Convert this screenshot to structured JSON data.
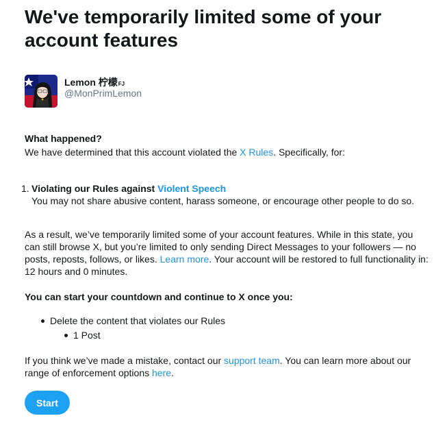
{
  "page": {
    "title_line1": "We've temporarily limited some of your",
    "title_line2": "account features"
  },
  "account": {
    "name": "Lemon 柠檬",
    "name_suffix": "FJ",
    "handle": "@MonPrimLemon"
  },
  "what_happened": {
    "heading": "What happened?",
    "text_before": "We have determined that this account violated the ",
    "rules_link": "X Rules",
    "text_after": ". Specifically, for:"
  },
  "violations": [
    {
      "number": "1.",
      "title_prefix": "Violating our Rules against ",
      "title_link": "Violent Speech",
      "description": "You may not share abusive content, harass someone, or encourage other people to do so."
    }
  ],
  "result": {
    "line1": "As a result, we’ve temporarily limited some of your account features. While in this state, you",
    "line2": "can still browse X, but you’re limited to only sending Direct Messages to your followers — no",
    "line3_before": "posts, reposts, follows, or likes. ",
    "learn_more_link": "Learn more",
    "line3_after": ". Your account will be restored to full functionality in:",
    "line4": "12 hours and 0 minutes."
  },
  "countdown": {
    "heading": "You can start your countdown and continue to X once you:",
    "bullet": "Delete the content that violates our Rules",
    "sub_bullet": "1 Post"
  },
  "mistake": {
    "text_before": "If you think we’ve made a mistake, contact our ",
    "support_link": "support team",
    "text_middle": ". You can learn more about our",
    "line2_before": "range of enforcement options ",
    "here_link": "here",
    "text_after": "."
  },
  "actions": {
    "start_label": "Start"
  },
  "colors": {
    "link": "#1b95e0",
    "button": "#1da1f2",
    "secondary_text": "#657786"
  }
}
